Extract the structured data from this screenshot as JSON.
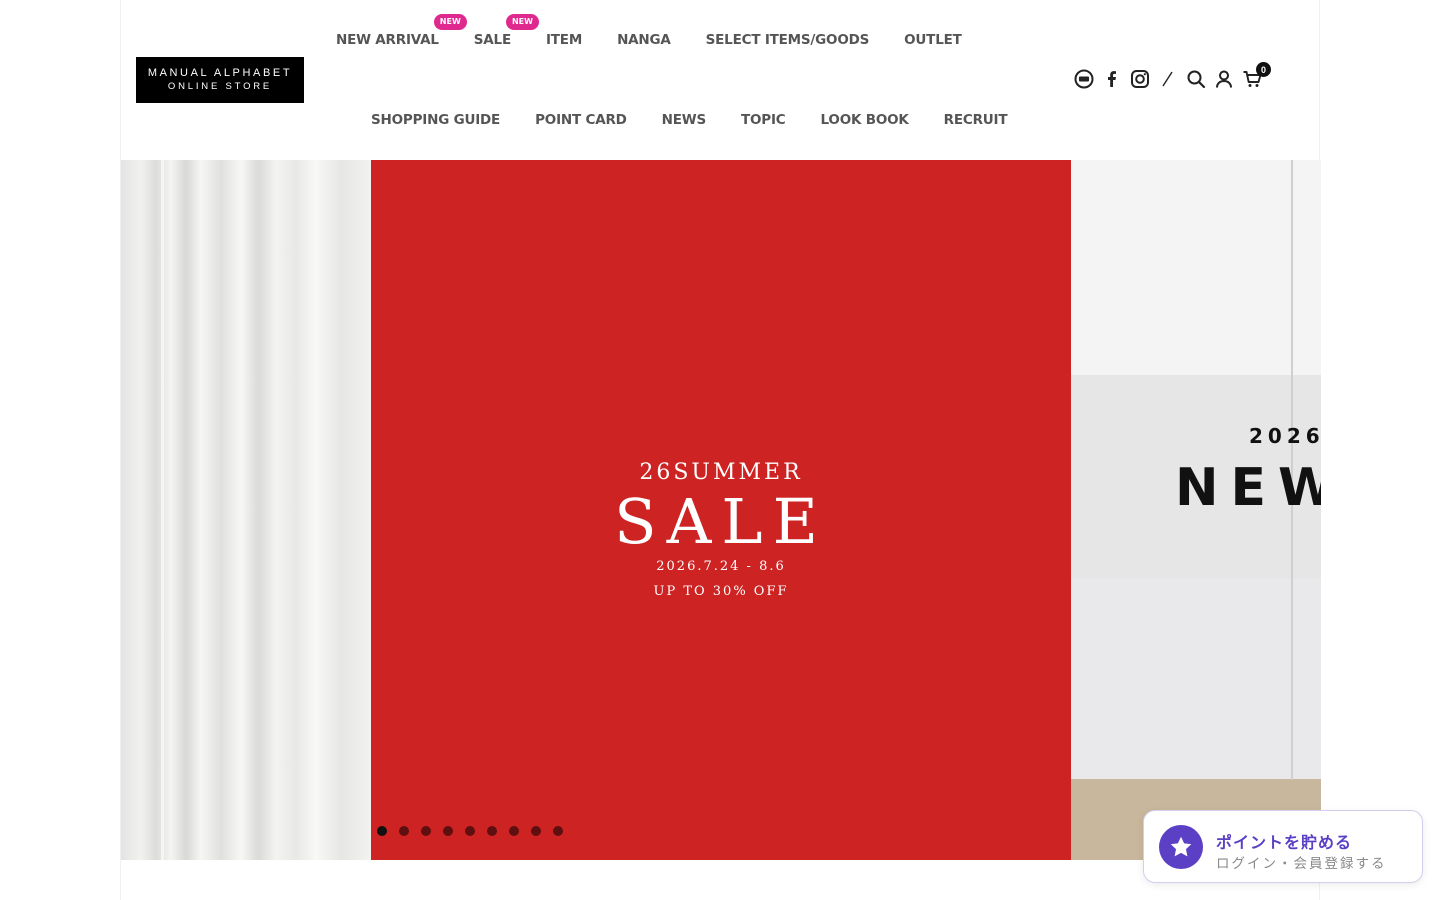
{
  "header": {
    "logo": {
      "line1": "MANUAL ALPHABET",
      "line2": "ONLINE STORE"
    },
    "nav_primary": [
      {
        "label": "NEW ARRIVAL",
        "badge": "NEW"
      },
      {
        "label": "SALE",
        "badge": "NEW"
      },
      {
        "label": "ITEM"
      },
      {
        "label": "NANGA"
      },
      {
        "label": "SELECT ITEMS/GOODS"
      },
      {
        "label": "OUTLET"
      }
    ],
    "nav_secondary": [
      {
        "label": "SHOPPING GUIDE"
      },
      {
        "label": "POINT CARD"
      },
      {
        "label": "NEWS"
      },
      {
        "label": "TOPIC"
      },
      {
        "label": "LOOK BOOK"
      },
      {
        "label": "RECRUIT"
      }
    ],
    "icons": [
      "line-icon",
      "facebook-icon",
      "instagram-icon",
      "divider-slash",
      "search-icon",
      "account-icon",
      "cart-icon"
    ],
    "cart_count": "0"
  },
  "slider": {
    "main": {
      "title": "26SUMMER",
      "headline": "SALE",
      "dates": "2026.7.24 - 8.6",
      "offer": "UP TO 30% OFF",
      "background": "#cd2323"
    },
    "right": {
      "year": "2026",
      "headline": "NEW"
    },
    "dots_count": 9,
    "active_dot": 1
  },
  "points_widget": {
    "title": "ポイントを貯める",
    "subtitle": "ログイン・会員登録する",
    "accent": "#5b3fc4"
  }
}
